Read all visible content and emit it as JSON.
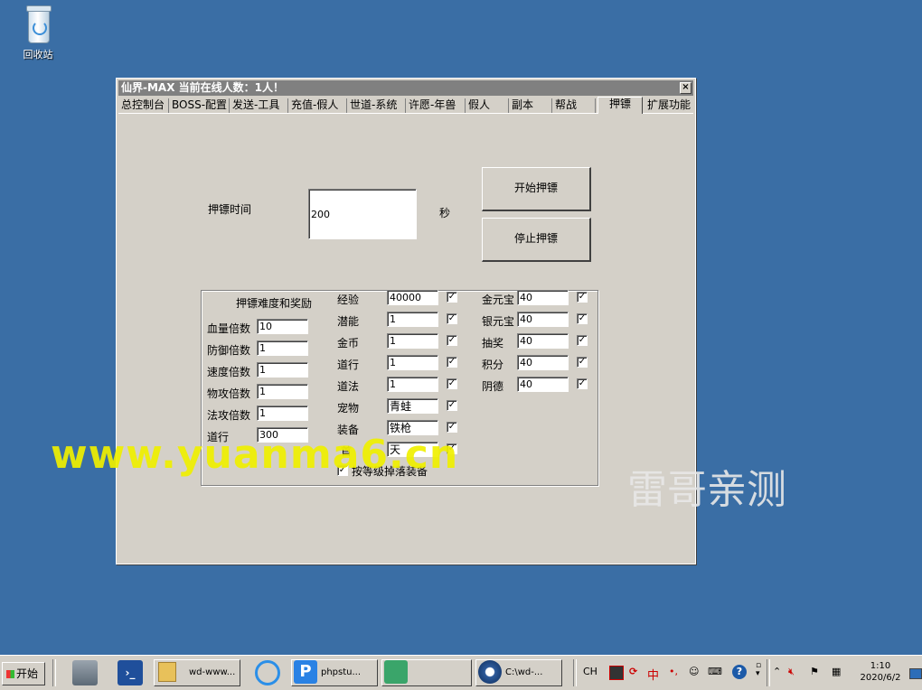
{
  "desktop": {
    "recycle_bin_label": "回收站"
  },
  "window": {
    "title": "仙界-MAX   当前在线人数：1人！",
    "close_glyph": "×",
    "tabs": [
      "总控制台",
      "BOSS-配置",
      "发送-工具",
      "充值-假人",
      "世道-系统",
      "许愿-年兽",
      "假人",
      "副本",
      "帮战",
      "押镖",
      "扩展功能"
    ],
    "active_tab": "押镖"
  },
  "escort": {
    "time_label": "押镖时间",
    "time_value": "200",
    "time_unit": "秒",
    "start_button": "开始押镖",
    "stop_button": "停止押镖"
  },
  "difficulty": {
    "heading": "押镖难度和奖励",
    "multipliers": [
      {
        "label": "血量倍数",
        "value": "10"
      },
      {
        "label": "防御倍数",
        "value": "1"
      },
      {
        "label": "速度倍数",
        "value": "1"
      },
      {
        "label": "物攻倍数",
        "value": "1"
      },
      {
        "label": "法攻倍数",
        "value": "1"
      },
      {
        "label": "道行",
        "value": "300"
      }
    ],
    "rewards_mid": [
      {
        "label": "经验",
        "value": "40000",
        "checked": true
      },
      {
        "label": "潜能",
        "value": "1",
        "checked": true
      },
      {
        "label": "金币",
        "value": "1",
        "checked": true
      },
      {
        "label": "道行",
        "value": "1",
        "checked": true
      },
      {
        "label": "道法",
        "value": "1",
        "checked": true
      },
      {
        "label": "宠物",
        "value": "青蛙",
        "checked": true
      },
      {
        "label": "装备",
        "value": "铁枪",
        "checked": true
      },
      {
        "label": "首",
        "value": "天",
        "checked": true
      }
    ],
    "rewards_right": [
      {
        "label": "金元宝",
        "value": "40",
        "checked": true
      },
      {
        "label": "银元宝",
        "value": "40",
        "checked": true
      },
      {
        "label": "抽奖",
        "value": "40",
        "checked": true
      },
      {
        "label": "积分",
        "value": "40",
        "checked": true
      },
      {
        "label": "阴德",
        "value": "40",
        "checked": true
      }
    ],
    "drop_checkbox_label": "按等级掉落装备",
    "drop_checked": true
  },
  "watermarks": {
    "url": "www.yuanma6.cn",
    "tester": "雷哥亲测"
  },
  "taskbar": {
    "start_label": "开始",
    "tasks": [
      "wd-www...",
      "phpstu...",
      "C:\\wd-..."
    ],
    "lang": "CH",
    "ime": "中",
    "time": "1:10",
    "date": "2020/6/2"
  }
}
